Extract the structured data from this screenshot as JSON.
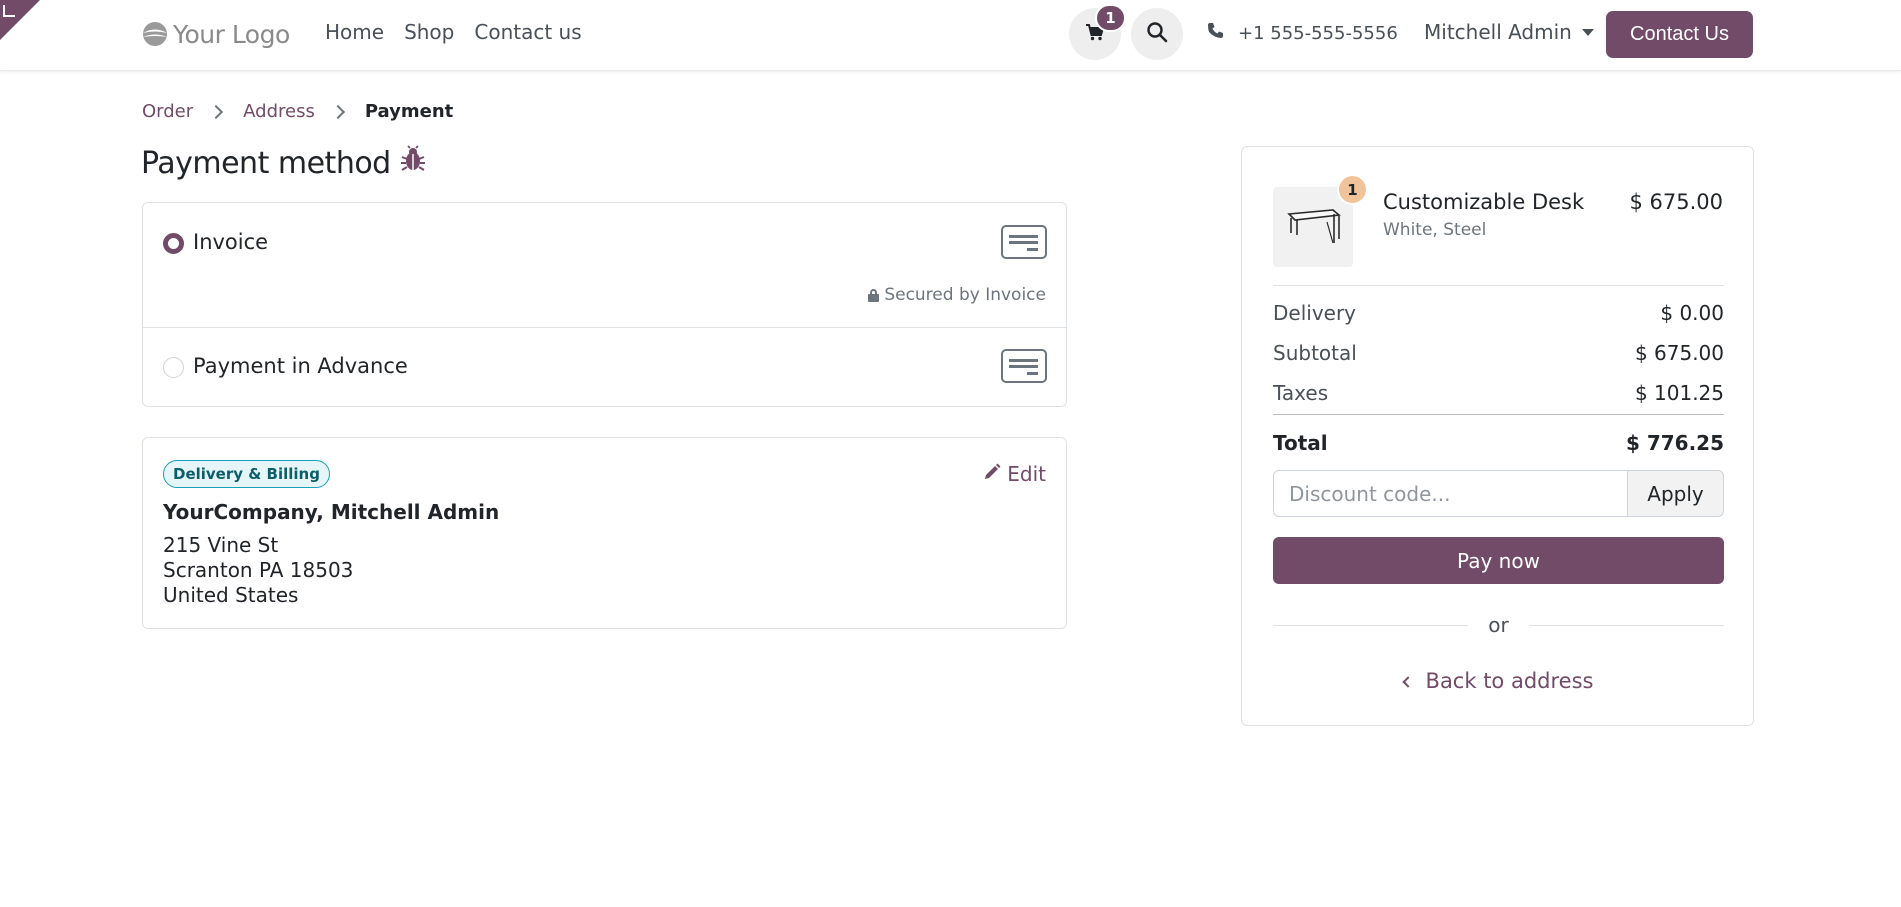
{
  "header": {
    "logo_text": "Your Logo",
    "nav": [
      "Home",
      "Shop",
      "Contact us"
    ],
    "cart_count": "1",
    "phone": "+1 555-555-5556",
    "user": "Mitchell Admin",
    "contact_button": "Contact Us",
    "accent_color": "#714b67"
  },
  "breadcrumb": {
    "order": "Order",
    "address": "Address",
    "payment": "Payment"
  },
  "page_title": "Payment method",
  "payment_methods": [
    {
      "label": "Invoice",
      "selected": true,
      "secured_text": "Secured by Invoice"
    },
    {
      "label": "Payment in Advance",
      "selected": false
    }
  ],
  "address": {
    "badge": "Delivery & Billing",
    "edit_label": "Edit",
    "name": "YourCompany, Mitchell Admin",
    "line1": "215 Vine St",
    "line2": "Scranton PA 18503",
    "line3": "United States"
  },
  "summary": {
    "product": {
      "qty": "1",
      "name": "Customizable Desk",
      "variant": "White, Steel",
      "price": "$ 675.00"
    },
    "delivery_label": "Delivery",
    "delivery_value": "$ 0.00",
    "subtotal_label": "Subtotal",
    "subtotal_value": "$ 675.00",
    "taxes_label": "Taxes",
    "taxes_value": "$ 101.25",
    "total_label": "Total",
    "total_value": "$ 776.25",
    "discount_placeholder": "Discount code...",
    "apply_label": "Apply",
    "pay_label": "Pay now",
    "or_label": "or",
    "back_label": "Back to address"
  }
}
